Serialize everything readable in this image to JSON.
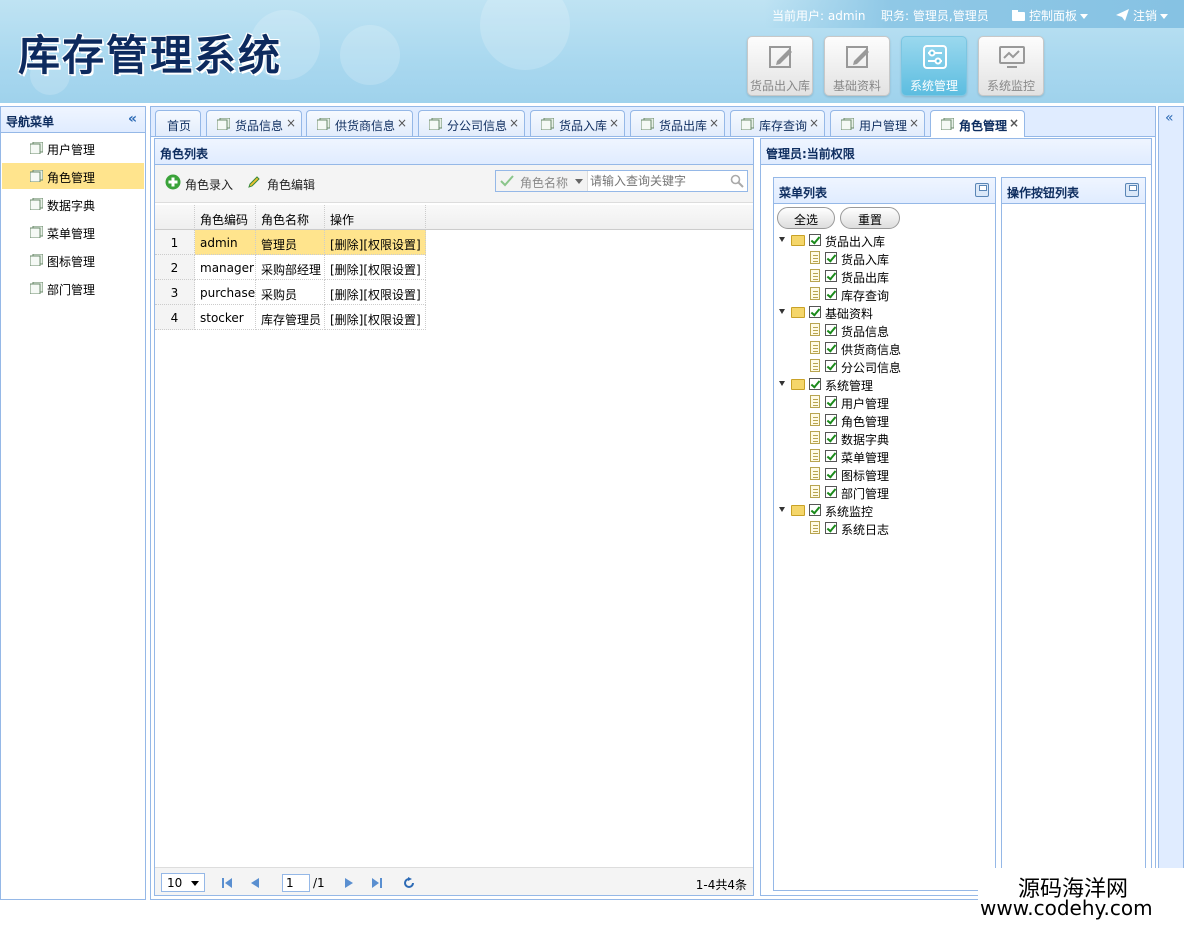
{
  "header": {
    "app_title": "库存管理系统",
    "current_user_label": "当前用户:",
    "current_user": "admin",
    "role_label": "职务:",
    "role_value": "管理员,管理员",
    "control_panel": "控制面板",
    "logout": "注销",
    "top_buttons": [
      {
        "label": "货品出入库",
        "icon": "edit-icon"
      },
      {
        "label": "基础资料",
        "icon": "edit-icon"
      },
      {
        "label": "系统管理",
        "icon": "sliders-icon"
      },
      {
        "label": "系统监控",
        "icon": "monitor-icon"
      }
    ]
  },
  "nav": {
    "title": "导航菜单",
    "items": [
      "用户管理",
      "角色管理",
      "数据字典",
      "菜单管理",
      "图标管理",
      "部门管理"
    ],
    "selected": "角色管理"
  },
  "tabs": [
    {
      "label": "首页",
      "closable": false
    },
    {
      "label": "货品信息",
      "closable": true
    },
    {
      "label": "供货商信息",
      "closable": true
    },
    {
      "label": "分公司信息",
      "closable": true
    },
    {
      "label": "货品入库",
      "closable": true
    },
    {
      "label": "货品出库",
      "closable": true
    },
    {
      "label": "库存查询",
      "closable": true
    },
    {
      "label": "用户管理",
      "closable": true
    },
    {
      "label": "角色管理",
      "closable": true,
      "active": true
    }
  ],
  "role_panel": {
    "title": "角色列表",
    "add_button": "角色录入",
    "edit_button": "角色编辑",
    "search_field": "角色名称",
    "search_placeholder": "请输入查询关键字",
    "columns": [
      "角色编码",
      "角色名称",
      "操作"
    ],
    "rows": [
      {
        "num": "1",
        "code": "admin",
        "name": "管理员",
        "ops": "[删除][权限设置]"
      },
      {
        "num": "2",
        "code": "manager",
        "name": "采购部经理",
        "ops": "[删除][权限设置]"
      },
      {
        "num": "3",
        "code": "purchaser",
        "name": "采购员",
        "ops": "[删除][权限设置]"
      },
      {
        "num": "4",
        "code": "stocker",
        "name": "库存管理员",
        "ops": "[删除][权限设置]"
      }
    ],
    "pager": {
      "page_size": "10",
      "page": "1",
      "total_pages": "/1",
      "summary": "1-4共4条"
    }
  },
  "perm_panel": {
    "title": "管理员:当前权限",
    "menu_list_title": "菜单列表",
    "button_list_title": "操作按钮列表",
    "select_all": "全选",
    "reset": "重置",
    "tree": [
      {
        "label": "货品出入库",
        "children": [
          "货品入库",
          "货品出库",
          "库存查询"
        ]
      },
      {
        "label": "基础资料",
        "children": [
          "货品信息",
          "供货商信息",
          "分公司信息"
        ]
      },
      {
        "label": "系统管理",
        "children": [
          "用户管理",
          "角色管理",
          "数据字典",
          "菜单管理",
          "图标管理",
          "部门管理"
        ]
      },
      {
        "label": "系统监控",
        "children": [
          "系统日志"
        ]
      }
    ]
  },
  "watermark": {
    "line1": "源码海洋网",
    "line2": "www.codehy.com"
  },
  "colors": {
    "accent": "#95b8e7",
    "header_bg": "#a9d8ef",
    "selected_row": "#ffe48d",
    "title_text": "#0d2a5e"
  }
}
